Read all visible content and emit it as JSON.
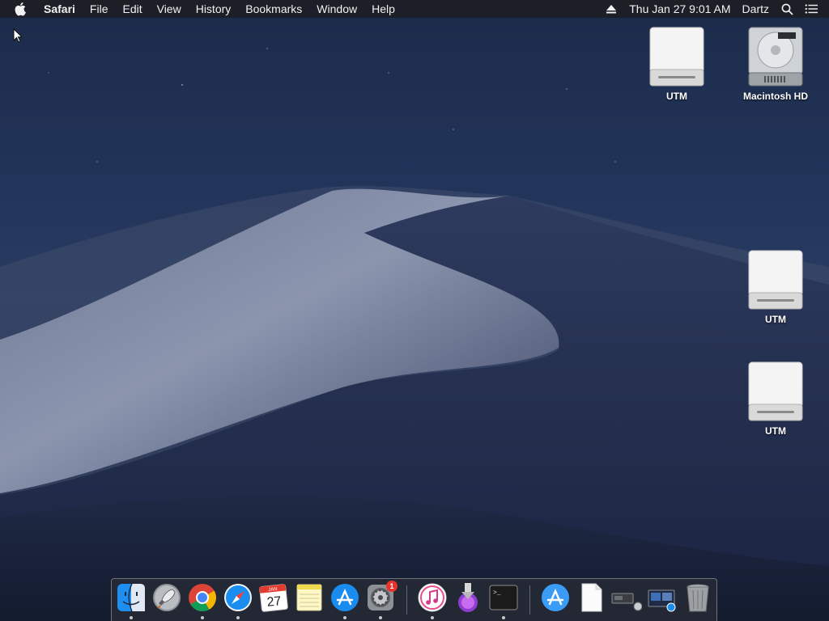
{
  "menubar": {
    "app_name": "Safari",
    "menus": [
      "File",
      "Edit",
      "View",
      "History",
      "Bookmarks",
      "Window",
      "Help"
    ],
    "clock": "Thu Jan 27  9:01 AM",
    "user": "Dartz"
  },
  "desktop_icons": [
    {
      "label": "UTM",
      "type": "external-drive"
    },
    {
      "label": "Macintosh HD",
      "type": "internal-drive"
    },
    {
      "label": "UTM",
      "type": "external-drive"
    },
    {
      "label": "UTM",
      "type": "external-drive"
    }
  ],
  "dock": {
    "calendar_month": "JAN",
    "calendar_day": "27",
    "system_prefs_badge": "1",
    "terminal_prompt": ">_"
  },
  "colors": {
    "menubar_bg": "#1c1e24",
    "badge": "#e9322d",
    "safari_blue": "#1a8cf0"
  }
}
